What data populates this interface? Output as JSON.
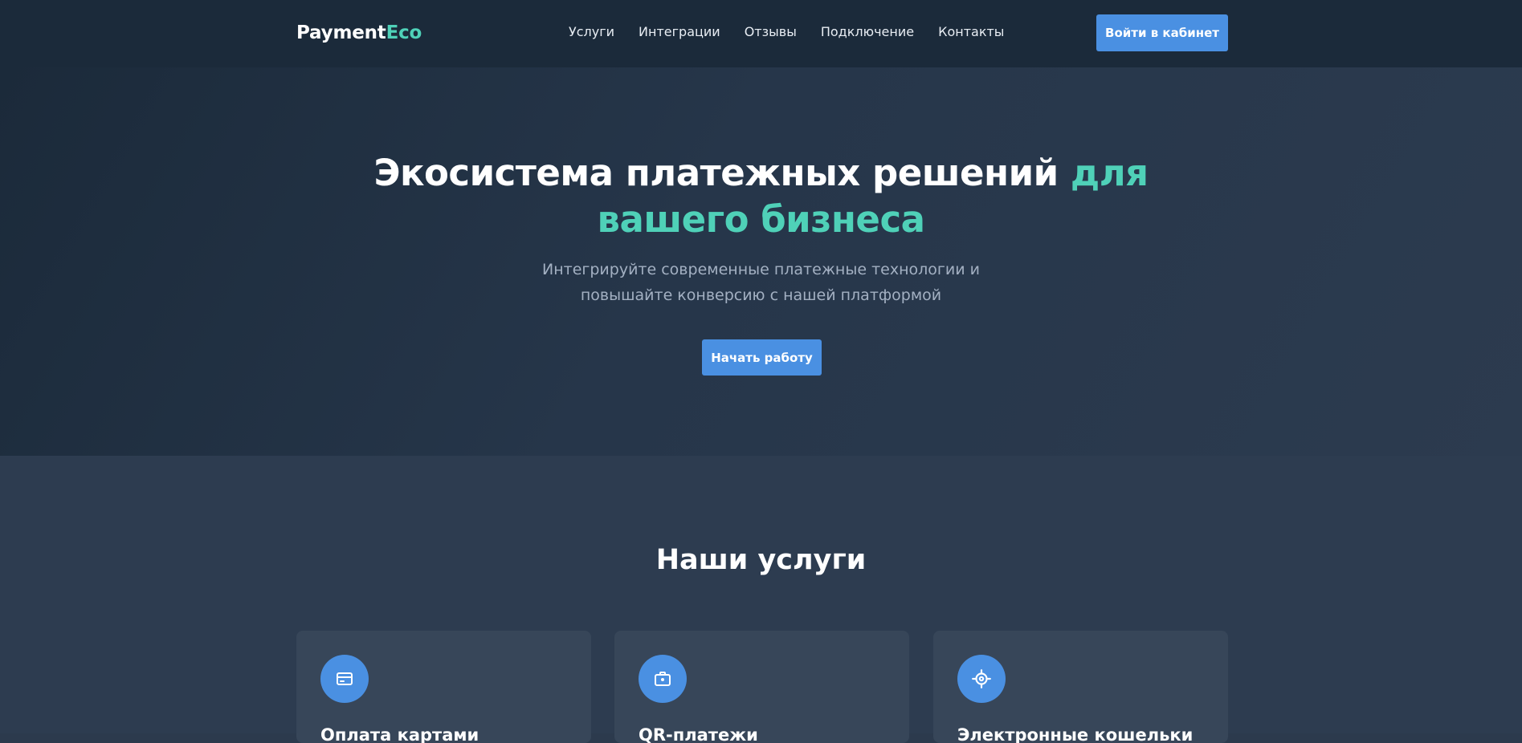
{
  "header": {
    "logo_main": "Payment",
    "logo_accent": "Eco",
    "nav": [
      "Услуги",
      "Интеграции",
      "Отзывы",
      "Подключение",
      "Контакты"
    ],
    "login_label": "Войти в кабинет"
  },
  "hero": {
    "title_main": "Экосистема платежных решений ",
    "title_accent": "для вашего бизнеса",
    "subtitle": "Интегрируйте современные платежные технологии и повышайте конверсию с нашей платформой",
    "cta_label": "Начать работу"
  },
  "services": {
    "title": "Наши услуги",
    "cards": [
      {
        "title": "Оплата картами",
        "icon": "card-icon"
      },
      {
        "title": "QR-платежи",
        "icon": "briefcase-icon"
      },
      {
        "title": "Электронные кошельки",
        "icon": "target-icon"
      }
    ]
  },
  "colors": {
    "accent": "#4fd1b8",
    "button": "#4a90e2",
    "header_bg": "#1b2a3a",
    "section_bg": "#2d3c50",
    "card_bg": "#374659"
  }
}
